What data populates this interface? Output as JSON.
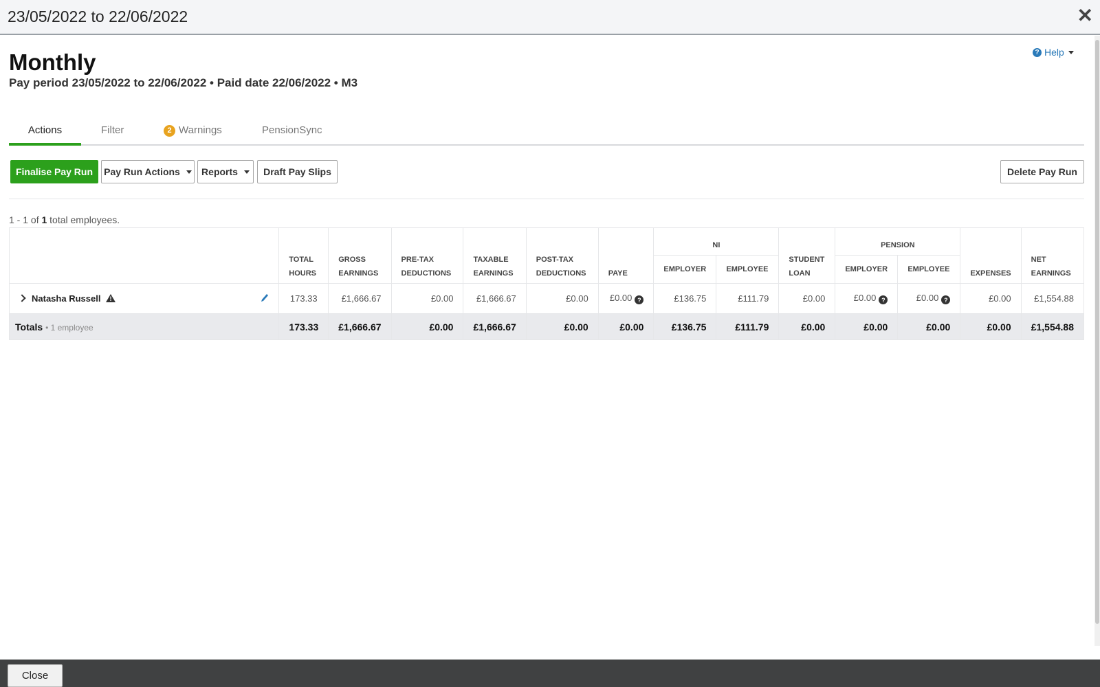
{
  "window": {
    "title": "23/05/2022 to 22/06/2022"
  },
  "help": {
    "label": "Help"
  },
  "page": {
    "title": "Monthly",
    "subtitle": "Pay period 23/05/2022 to 22/06/2022 • Paid date 22/06/2022 • M3"
  },
  "tabs": [
    {
      "label": "Actions",
      "active": true
    },
    {
      "label": "Filter"
    },
    {
      "label": "Warnings",
      "badge": "2"
    },
    {
      "label": "PensionSync"
    }
  ],
  "toolbar": {
    "finalise": "Finalise Pay Run",
    "pay_run_actions": "Pay Run Actions",
    "reports": "Reports",
    "draft_pay_slips": "Draft Pay Slips",
    "delete": "Delete Pay Run"
  },
  "count": {
    "prefix": "1 - 1 of",
    "total": "1",
    "suffix": "total employees."
  },
  "table": {
    "groups": {
      "ni": "NI",
      "pension": "PENSION"
    },
    "headers": {
      "total_hours": [
        "TOTAL",
        "HOURS"
      ],
      "gross": [
        "GROSS",
        "EARNINGS"
      ],
      "pretax": [
        "PRE-TAX",
        "DEDUCTIONS"
      ],
      "taxable": [
        "TAXABLE",
        "EARNINGS"
      ],
      "posttax": [
        "POST-TAX",
        "DEDUCTIONS"
      ],
      "paye": "PAYE",
      "ni_employer": "EMPLOYER",
      "ni_employee": "EMPLOYEE",
      "student_loan": [
        "STUDENT",
        "LOAN"
      ],
      "pension_employer": "EMPLOYER",
      "pension_employee": "EMPLOYEE",
      "expenses": "EXPENSES",
      "net": [
        "NET",
        "EARNINGS"
      ]
    },
    "row": {
      "name": "Natasha Russell",
      "total_hours": "173.33",
      "gross": "£1,666.67",
      "pretax": "£0.00",
      "taxable": "£1,666.67",
      "posttax": "£0.00",
      "paye": "£0.00",
      "ni_employer": "£136.75",
      "ni_employee": "£111.79",
      "student_loan": "£0.00",
      "pension_employer": "£0.00",
      "pension_employee": "£0.00",
      "expenses": "£0.00",
      "net": "£1,554.88"
    },
    "totals": {
      "label": "Totals",
      "sub": "• 1 employee",
      "total_hours": "173.33",
      "gross": "£1,666.67",
      "pretax": "£0.00",
      "taxable": "£1,666.67",
      "posttax": "£0.00",
      "paye": "£0.00",
      "ni_employer": "£136.75",
      "ni_employee": "£111.79",
      "student_loan": "£0.00",
      "pension_employer": "£0.00",
      "pension_employee": "£0.00",
      "expenses": "£0.00",
      "net": "£1,554.88"
    }
  },
  "footer": {
    "close": "Close"
  },
  "colors": {
    "accent": "#2ca01c",
    "badge": "#e8a31f",
    "link": "#2a7ab9"
  }
}
